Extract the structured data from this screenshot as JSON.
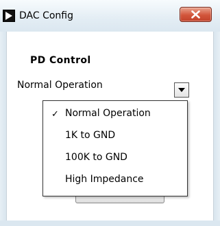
{
  "window": {
    "title": "DAC Config",
    "app_icon": "play-triangle-icon",
    "close_icon": "close-icon",
    "close_color": "#c9472d"
  },
  "pd_control": {
    "label": "PD Control",
    "selected": "Normal Operation",
    "dropdown_icon": "chevron-down-icon",
    "options": [
      {
        "label": "Normal Operation",
        "checked": true
      },
      {
        "label": "1K to GND",
        "checked": false
      },
      {
        "label": "100K to GND",
        "checked": false
      },
      {
        "label": "High Impedance",
        "checked": false
      }
    ],
    "check_mark": "✓"
  }
}
